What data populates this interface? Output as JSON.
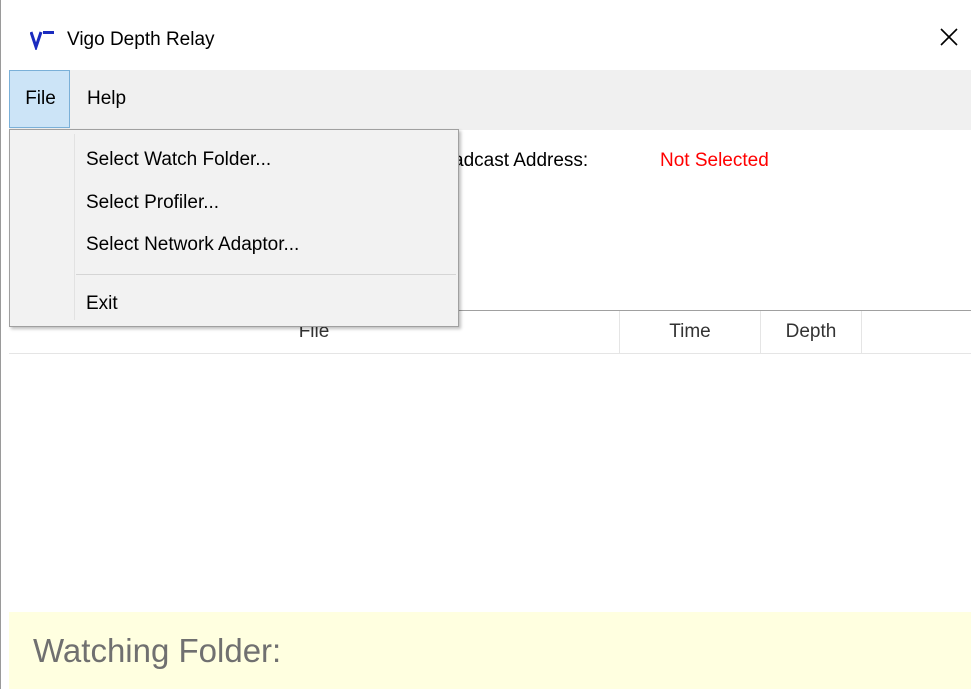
{
  "window": {
    "title": "Vigo Depth Relay",
    "close_icon": "close-icon",
    "logo_icon": "vigo-logo-icon"
  },
  "menubar": {
    "file_label": "File",
    "help_label": "Help"
  },
  "file_menu": {
    "items": [
      {
        "label": "Select Watch Folder..."
      },
      {
        "label": "Select Profiler..."
      },
      {
        "label": "Select Network Adaptor..."
      },
      {
        "label": "Exit"
      }
    ]
  },
  "main": {
    "broadcast_label_partial": "adcast Address:",
    "broadcast_value": "Not Selected",
    "broadcast_value_color": "#ff0000"
  },
  "listview": {
    "columns": [
      "File",
      "Time",
      "Depth"
    ],
    "rows": []
  },
  "status": {
    "text": "Watching Folder:",
    "background": "#ffffe0"
  }
}
